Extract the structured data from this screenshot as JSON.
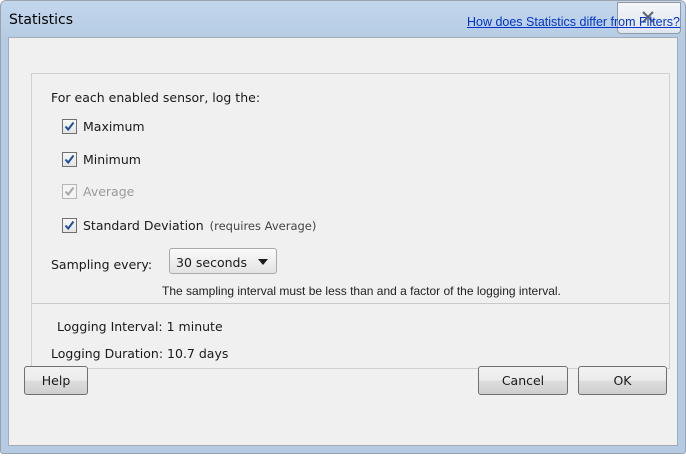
{
  "window": {
    "title": "Statistics"
  },
  "link": {
    "text": "How does Statistics differ from Filters?"
  },
  "stats": {
    "intro": "For each enabled sensor, log the:",
    "options": [
      {
        "label": "Maximum",
        "checked": true,
        "enabled": true
      },
      {
        "label": "Minimum",
        "checked": true,
        "enabled": true
      },
      {
        "label": "Average",
        "checked": true,
        "enabled": false
      },
      {
        "label": "Standard Deviation",
        "checked": true,
        "enabled": true,
        "hint": "(requires Average)"
      }
    ]
  },
  "sampling": {
    "label": "Sampling every:",
    "selected": "30 seconds",
    "note": "The sampling interval must be less than and a factor of the logging interval."
  },
  "info": {
    "interval": "Logging Interval: 1 minute",
    "duration": "Logging Duration: 10.7 days"
  },
  "buttons": {
    "help": "Help",
    "cancel": "Cancel",
    "ok": "OK"
  },
  "colors": {
    "link": "#0033cc",
    "check": "#1f4f9a",
    "titlebar": "#b9cfe6"
  }
}
